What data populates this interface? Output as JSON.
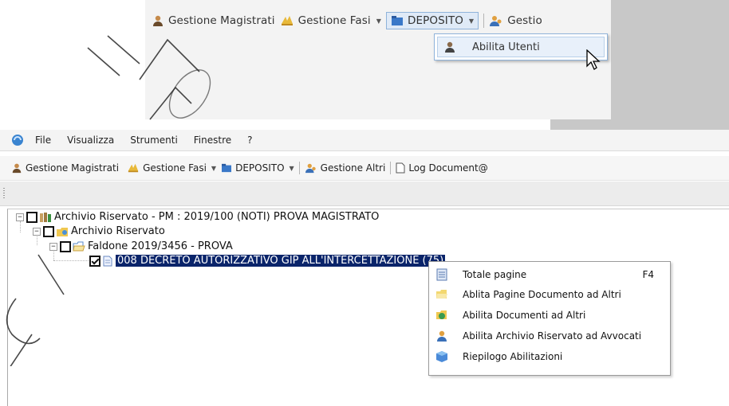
{
  "inset": {
    "toolbar": [
      {
        "label": "Gestione Magistrati",
        "icon": "users-icon"
      },
      {
        "label": "Gestione Fasi",
        "icon": "phases-icon",
        "dropdown": true
      },
      {
        "label": "DEPOSITO",
        "icon": "folder-icon",
        "dropdown": true,
        "active": true
      },
      {
        "label": "Gestio",
        "icon": "user-group-icon"
      }
    ],
    "menu_item": "Abilita Utenti"
  },
  "app": {
    "menu": [
      "File",
      "Visualizza",
      "Strumenti",
      "Finestre",
      "?"
    ],
    "toolbar": {
      "gestione_magistrati": "Gestione Magistrati",
      "gestione_fasi": "Gestione Fasi",
      "deposito": "DEPOSITO",
      "gestione_altri": "Gestione Altri",
      "log_document": "Log Document@"
    },
    "tree": {
      "root": "Archivio Riservato - PM : 2019/100 (NOTI) PROVA MAGISTRATO",
      "archivio": "Archivio Riservato",
      "faldone": "Faldone 2019/3456 - PROVA",
      "documento": "008 DECRETO AUTORIZZATIVO GIP ALL'INTERCETTAZIONE (75)"
    },
    "context_menu": [
      {
        "label": "Totale pagine",
        "shortcut": "F4",
        "icon": "pages-icon"
      },
      {
        "label": "Ablita Pagine Documento ad Altri",
        "icon": "folder-open-icon"
      },
      {
        "label": "Abilita Documenti ad Altri",
        "icon": "document-share-icon"
      },
      {
        "label": "Abilita Archivio Riservato ad Avvocati",
        "icon": "lawyer-icon"
      },
      {
        "label": "Riepilogo Abilitazioni",
        "icon": "summary-icon"
      }
    ]
  },
  "colors": {
    "selection": "#0a246a",
    "menu_highlight": "#e8f0fa",
    "highlight_border": "#8fb3da"
  }
}
